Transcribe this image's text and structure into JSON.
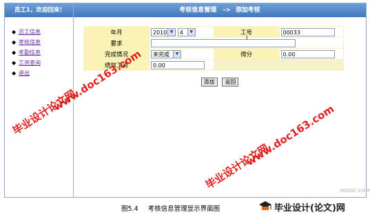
{
  "sidebar": {
    "greeting": "员工1，欢迎回来！",
    "items": [
      {
        "label": "员工信息"
      },
      {
        "label": "考核信息"
      },
      {
        "label": "考勤信息"
      },
      {
        "label": "工资查询"
      },
      {
        "label": "退出"
      }
    ]
  },
  "header": {
    "section": "考核信息管理",
    "arrow": "->",
    "page": "添加考核"
  },
  "form": {
    "year_month_label": "年月",
    "year_value": "2010",
    "month_value": "4",
    "employee_id_label": "工号",
    "employee_id_value": "00033",
    "requirement_label": "要求",
    "requirement_value": "",
    "completion_label": "完成情况",
    "completion_value": "未完成",
    "score_label": "得分",
    "score_value": "0.00",
    "performance_pay_label": "绩效工资",
    "performance_pay_value": "0.00"
  },
  "buttons": {
    "add": "添加",
    "back": "返回"
  },
  "watermarks": {
    "cn_text": "毕业设计论文网",
    "url_text": "www.doc163.com"
  },
  "caption": {
    "figure_no": "图5.4",
    "title": "考核信息管理显示界面图"
  },
  "logo": {
    "text": "毕业设计(论文)网",
    "site": "56DOC.COM"
  },
  "colors": {
    "header_blue": "#4a82c6",
    "form_label_bg": "#fbf3b6",
    "watermark_red": "#e21f1f",
    "link_purple": "#6c2ca0"
  }
}
